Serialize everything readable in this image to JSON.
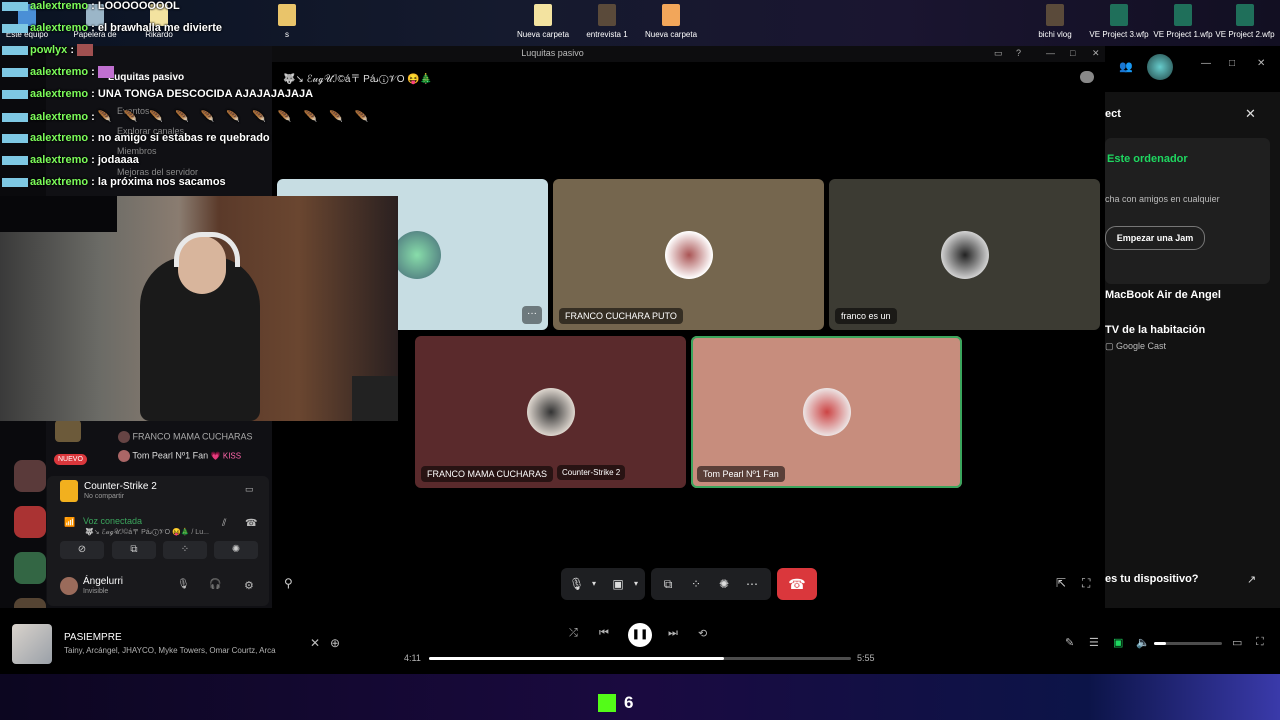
{
  "desktop": {
    "icons": [
      "Este equipo",
      "Papelera de",
      "Rikardo",
      "s",
      "Nueva carpeta",
      "entrevista 1",
      "Nueva carpeta",
      "bichi vlog",
      "VE Project 3.wfp",
      "VE Project 1.wfp",
      "VE Project 2.wfp"
    ]
  },
  "chat": {
    "messages": [
      {
        "user": "aalextremo",
        "text": ": LOOOOOOOOL"
      },
      {
        "user": "aalextremo",
        "text": ": el brawhalla me divierte"
      },
      {
        "user": "powlyx",
        "text": ":"
      },
      {
        "user": "aalextremo",
        "text": ":"
      },
      {
        "user": "aalextremo",
        "text": ": UNA TONGA DESCOCIDA AJAJAJAJAJA"
      },
      {
        "user": "aalextremo",
        "text": ":"
      },
      {
        "user": "aalextremo",
        "text": ": no amigo si estabas re quebrado"
      },
      {
        "user": "aalextremo",
        "text": ": jodaaaa"
      },
      {
        "user": "aalextremo",
        "text": ": la próxima nos sacamos"
      }
    ]
  },
  "discord": {
    "window_title": "Luquitas pasivo",
    "server_name": "Luquitas pasivo",
    "channel_title": "🐺↘ ℰ𝓊ℊ𝒰ℐ©á〒 Pá𝓈ⓘ𝒱O 😝🎄",
    "side_items": [
      "Eventos",
      "Explorar canales",
      "Miembros",
      "Mejoras del servidor"
    ],
    "voice_members": [
      {
        "name": "FRANCO MAMA CUCHARAS",
        "tag": ""
      },
      {
        "name": "Tom Pearl Nº1 Fan",
        "tag": "💗 KISS"
      }
    ],
    "new_badge": "NUEVO",
    "activity": {
      "title": "Counter-Strike 2",
      "subtitle": "No compartir"
    },
    "voice_status": {
      "label": "Voz conectada",
      "channel": "🐺↘ ℰ𝓊ℊ𝒰ℐ©á〒 Pá𝓈ⓘ𝒱O 😝🎄 / Lu..."
    },
    "user": {
      "name": "Ángelurri",
      "status": "Invisible"
    },
    "tiles": [
      {
        "label": "FRANCO CUCHARA PUTO",
        "bg": "#75664e"
      },
      {
        "label": "franco es un",
        "bg": "#3c3b33"
      },
      {
        "label": "FRANCO MAMA CUCHARAS",
        "bg": "#5a2a2c",
        "game": "Counter-Strike 2"
      },
      {
        "label": "Tom Pearl Nº1 Fan",
        "bg": "#c78d7d"
      }
    ],
    "screenshare_bg": "#c7dde3"
  },
  "spotify": {
    "panel": {
      "heading": "ect",
      "this_device": "Este ordenador",
      "jam_text": "cha con amigos en cualquier",
      "jam_button": "Empezar una Jam",
      "device1": "MacBook Air de Angel",
      "device2": "TV de la habitación",
      "device2_sub": "Google Cast",
      "help": "es tu dispositivo?"
    },
    "track": {
      "title": "PASIEMPRE",
      "artists": "Tainy, Arcángel, JHAYCO, Myke Towers, Omar Courtz, Arca",
      "elapsed": "4:11",
      "total": "5:55",
      "progress": 0.7
    },
    "volume": 0.18,
    "accent": "#1ed760"
  },
  "stream": {
    "viewers": "6",
    "kick_color": "#53fc18"
  }
}
